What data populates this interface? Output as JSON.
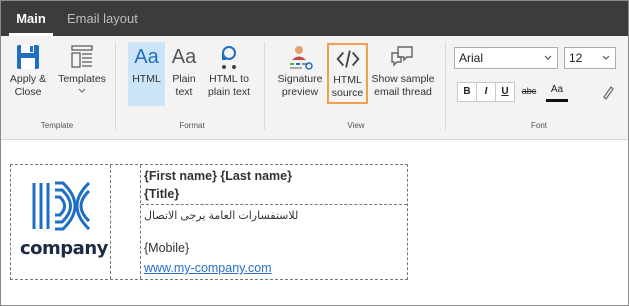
{
  "tabs": [
    {
      "label": "Main",
      "active": true
    },
    {
      "label": "Email layout",
      "active": false
    }
  ],
  "ribbon": {
    "template": {
      "group_label": "Template",
      "apply_close": "Apply & Close",
      "templates": "Templates"
    },
    "format": {
      "group_label": "Format",
      "html": "HTML",
      "plain_text": "Plain text",
      "html_to_plain": "HTML to plain text",
      "html_glyph": "Aa",
      "plain_glyph": "Aa"
    },
    "view": {
      "group_label": "View",
      "signature_preview": "Signature preview",
      "html_source": "HTML source",
      "show_sample": "Show sample email thread"
    },
    "font": {
      "group_label": "Font",
      "family_value": "Arial",
      "size_value": "12",
      "bold": "B",
      "italic": "I",
      "underline": "U",
      "strike": "abc",
      "font_color": "Aa"
    }
  },
  "signature": {
    "logo_text": "company",
    "name": "{First name} {Last name}",
    "title": "{Title}",
    "arabic": "للاستفسارات العامة يرجى الاتصال",
    "mobile": "{Mobile}",
    "website": "www.my-company.com"
  },
  "colors": {
    "tabbar": "#3c3c3c",
    "ribbon": "#f3f3f3",
    "accent_blue": "#1e6fc4",
    "active_button": "#cce4f7",
    "highlight_orange": "#f0a04b",
    "link": "#2a6fc9"
  }
}
